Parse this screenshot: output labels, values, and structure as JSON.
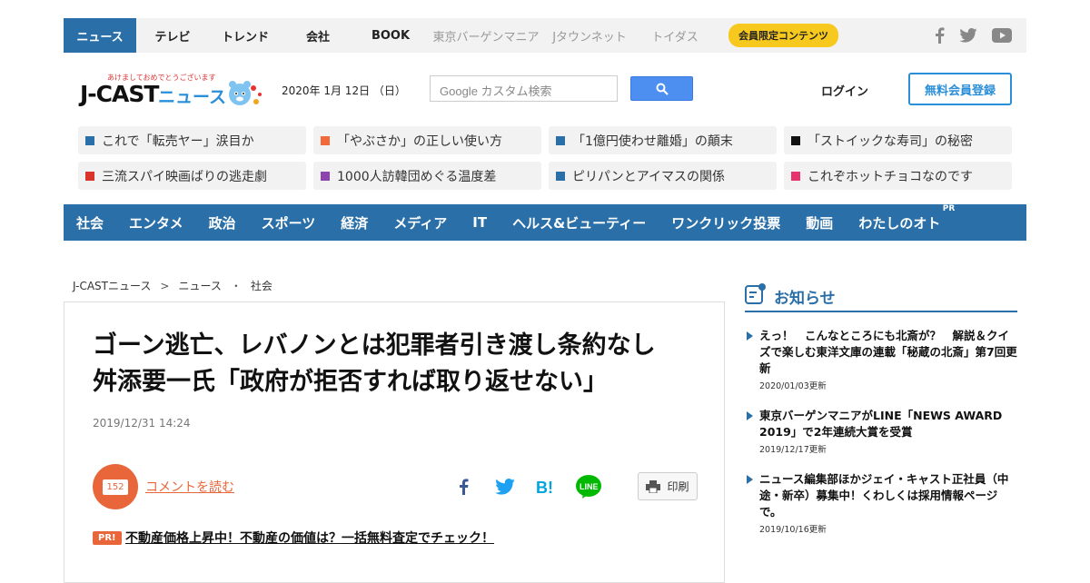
{
  "topnav": {
    "items": [
      {
        "label": "ニュース",
        "active": true
      },
      {
        "label": "テレビ"
      },
      {
        "label": "トレンド"
      },
      {
        "label": "会社"
      },
      {
        "label": "BOOK"
      },
      {
        "label": "東京バーゲンマニア",
        "dim": true
      },
      {
        "label": "Jタウンネット",
        "dim": true
      },
      {
        "label": "トイダス",
        "dim": true
      }
    ],
    "badge": "会員限定コンテンツ",
    "social": [
      "facebook-icon",
      "twitter-icon",
      "youtube-icon"
    ]
  },
  "header": {
    "logo_tagline": "あけましておめでとうございます",
    "logo_main": "J-CAST",
    "logo_sub": "ニュース",
    "date": "2020年 1月 12日 （日）",
    "search_placeholder": "Google カスタム検索",
    "login": "ログイン",
    "register": "無料会員登録"
  },
  "trending": [
    {
      "label": "これで「転売ヤー」涙目か",
      "color": "#2a6fa8"
    },
    {
      "label": "「やぶさか」の正しい使い方",
      "color": "#f26a3a"
    },
    {
      "label": "「1億円使わせ離婚」の顛末",
      "color": "#2a6fa8"
    },
    {
      "label": "「ストイックな寿司」の秘密",
      "color": "#111111"
    },
    {
      "label": "三流スパイ映画ばりの逃走劇",
      "color": "#d9342b"
    },
    {
      "label": "1000人訪韓団めぐる温度差",
      "color": "#8e44ad"
    },
    {
      "label": "ピリパンとアイマスの関係",
      "color": "#2a6fa8"
    },
    {
      "label": "これぞホットチョコなのです",
      "color": "#e6336e"
    }
  ],
  "categories": [
    "社会",
    "エンタメ",
    "政治",
    "スポーツ",
    "経済",
    "メディア",
    "IT",
    "ヘルス&ビューティー",
    "ワンクリック投票",
    "動画",
    "わたしのオト"
  ],
  "category_pr": "PR",
  "breadcrumb": [
    "J-CASTニュース",
    "ニュース",
    "社会"
  ],
  "breadcrumb_seps": [
    ">",
    "・"
  ],
  "article": {
    "title": "ゴーン逃亡、レバノンとは犯罪者引き渡し条約なし　舛添要一氏「政府が拒否すれば取り返せない」",
    "date": "2019/12/31 14:24",
    "comment_count": "152",
    "comment_link": "コメントを読む",
    "print": "印刷",
    "pr_label": "PR!",
    "pr_link": "不動産価格上昇中！不動産の価値は？一括無料査定でチェック！"
  },
  "notices": {
    "title": "お知らせ",
    "items": [
      {
        "text": "えっ！　こんなところにも北斎が？　解説＆クイズで楽しむ東洋文庫の連載「秘蔵の北斎」第7回更新",
        "date": "2020/01/03更新"
      },
      {
        "text": "東京バーゲンマニアがLINE「NEWS AWARD 2019」で2年連続大賞を受賞",
        "date": "2019/12/17更新"
      },
      {
        "text": "ニュース編集部ほかジェイ・キャスト正社員（中途・新卒）募集中！くわしくは採用情報ページで。",
        "date": "2019/10/16更新"
      }
    ]
  }
}
